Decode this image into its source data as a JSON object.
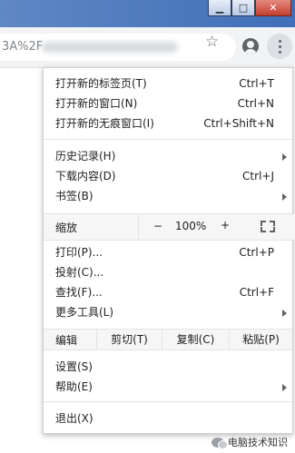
{
  "browser": {
    "url_text": "3A%2F",
    "window_buttons": {
      "minimize": "▁",
      "maximize": "□",
      "close": "✕"
    },
    "icons": [
      "star-icon",
      "profile-icon",
      "more-vert-icon"
    ]
  },
  "menu": {
    "new_tab": {
      "label": "打开新的标签页(T)",
      "shortcut": "Ctrl+T"
    },
    "new_window": {
      "label": "打开新的窗口(N)",
      "shortcut": "Ctrl+N"
    },
    "incognito": {
      "label": "打开新的无痕窗口(I)",
      "shortcut": "Ctrl+Shift+N"
    },
    "history": {
      "label": "历史记录(H)"
    },
    "downloads": {
      "label": "下载内容(D)",
      "shortcut": "Ctrl+J"
    },
    "bookmarks": {
      "label": "书签(B)"
    },
    "zoom": {
      "label": "缩放",
      "minus": "−",
      "value": "100%",
      "plus": "+"
    },
    "print": {
      "label": "打印(P)...",
      "shortcut": "Ctrl+P"
    },
    "cast": {
      "label": "投射(C)..."
    },
    "find": {
      "label": "查找(F)...",
      "shortcut": "Ctrl+F"
    },
    "more_tools": {
      "label": "更多工具(L)"
    },
    "edit": {
      "label": "编辑",
      "cut": "剪切(T)",
      "copy": "复制(C)",
      "paste": "粘贴(P)"
    },
    "settings": {
      "label": "设置(S)"
    },
    "help": {
      "label": "帮助(E)"
    },
    "exit": {
      "label": "退出(X)"
    }
  },
  "watermark": {
    "text": "电脑技术知识"
  }
}
